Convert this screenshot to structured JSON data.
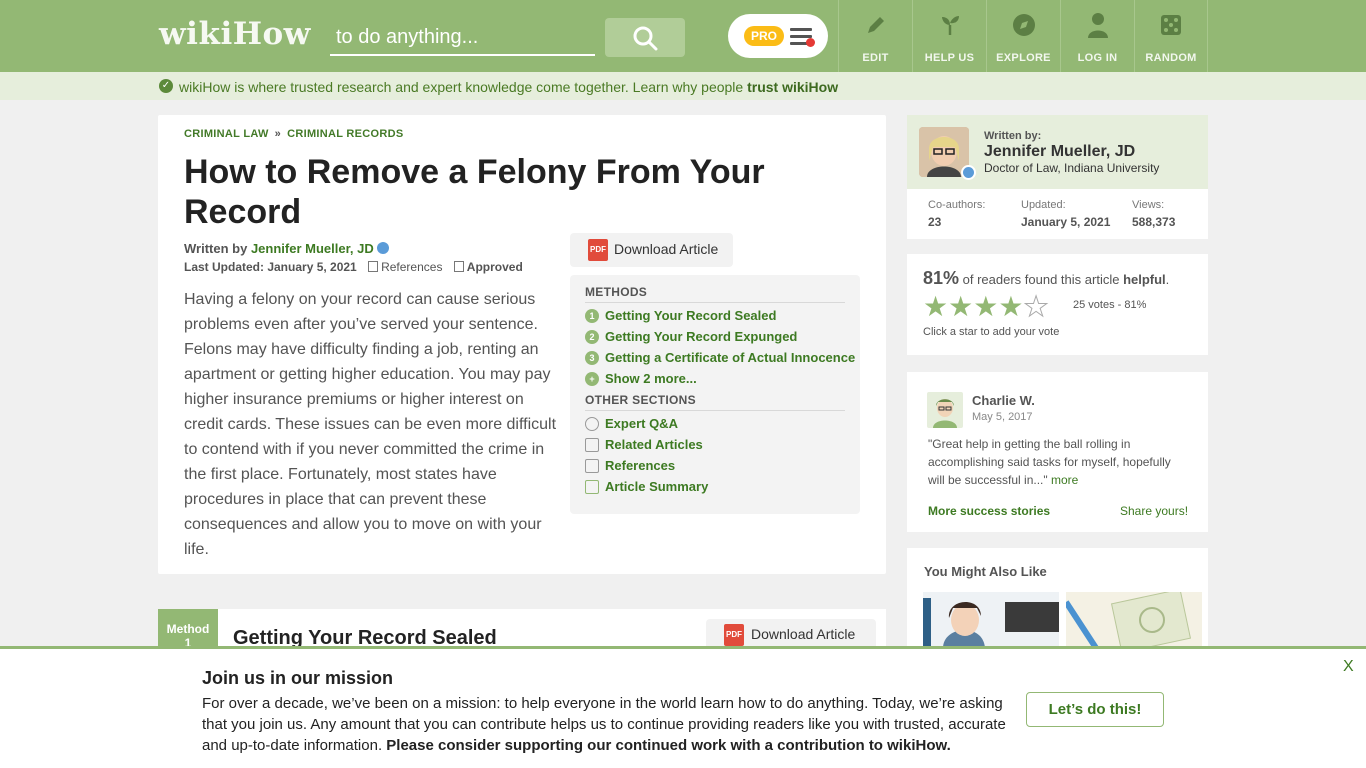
{
  "header": {
    "logo": {
      "wiki": "wiki",
      "how": "How"
    },
    "search_placeholder": "to do anything...",
    "pro_label": "PRO",
    "nav": [
      {
        "label": "EDIT",
        "icon": "pencil-icon"
      },
      {
        "label": "HELP US",
        "icon": "sprout-icon"
      },
      {
        "label": "EXPLORE",
        "icon": "compass-icon"
      },
      {
        "label": "LOG IN",
        "icon": "user-icon"
      },
      {
        "label": "RANDOM",
        "icon": "dice-icon"
      }
    ]
  },
  "trust_bar": {
    "text": "wikiHow is where trusted research and expert knowledge come together. Learn why people ",
    "link": "trust wikiHow"
  },
  "article": {
    "breadcrumb": [
      "CRIMINAL LAW",
      "CRIMINAL RECORDS"
    ],
    "breadcrumb_sep": "»",
    "title": "How to Remove a Felony From Your Record",
    "written_by_label": "Written by ",
    "author": "Jennifer Mueller, JD",
    "last_updated": "Last Updated: January 5, 2021",
    "references_label": "References",
    "approved_label": "Approved",
    "intro": "Having a felony on your record can cause serious problems even after you’ve served your sentence. Felons may have difficulty finding a job, renting an apartment or getting higher education. You may pay higher insurance premiums or higher interest on credit cards. These issues can be even more difficult to contend with if you never committed the crime in the first place. Fortunately, most states have procedures in place that can prevent these consequences and allow you to move on with your life.",
    "download_label": "Download Article",
    "pdf_label": "PDF"
  },
  "toc": {
    "methods_heading": "METHODS",
    "methods": [
      {
        "num": "1",
        "label": "Getting Your Record Sealed"
      },
      {
        "num": "2",
        "label": "Getting Your Record Expunged"
      },
      {
        "num": "3",
        "label": "Getting a Certificate of Actual Innocence"
      },
      {
        "num": "+",
        "label": "Show 2 more..."
      }
    ],
    "other_heading": "OTHER SECTIONS",
    "other": [
      {
        "label": "Expert Q&A",
        "icon": "question-icon"
      },
      {
        "label": "Related Articles",
        "icon": "document-icon"
      },
      {
        "label": "References",
        "icon": "clipboard-icon"
      },
      {
        "label": "Article Summary",
        "icon": "summary-icon"
      }
    ]
  },
  "author_card": {
    "written_by": "Written by:",
    "name": "Jennifer Mueller, JD",
    "credential": "Doctor of Law, Indiana University",
    "coauthors_label": "Co-authors:",
    "coauthors": "23",
    "updated_label": "Updated:",
    "updated": "January 5, 2021",
    "views_label": "Views:",
    "views": "588,373"
  },
  "rating": {
    "percent": "81%",
    "text_pre": " of readers found this article ",
    "text_bold": "helpful",
    "text_post": ".",
    "stars_filled": 4,
    "stars_total": 5,
    "votes": "25 votes - 81%",
    "click_hint": "Click a star to add your vote"
  },
  "success": {
    "name": "Charlie W.",
    "date": "May 5, 2017",
    "quote": "\"Great help in getting the ball rolling in accomplishing said tasks for myself, hopefully will be successful in...\" ",
    "more": "more",
    "more_stories": "More success stories",
    "share": "Share yours!"
  },
  "also_like": {
    "title": "You Might Also Like"
  },
  "method1": {
    "tag": "Method",
    "number": "1",
    "title": "Getting Your Record Sealed",
    "download_label": "Download Article"
  },
  "banner": {
    "heading": "Join us in our mission",
    "body": "For over a decade, we’ve been on a mission: to help everyone in the world learn how to do anything. Today, we’re asking that you join us. Any amount that you can contribute helps us to continue providing readers like you with trusted, accurate and up-to-date information. ",
    "body_bold": "Please consider supporting our continued work with a contribution to wikiHow.",
    "cta": "Let’s do this!",
    "close": "X"
  },
  "colors": {
    "brand_green": "#93b874",
    "link_green": "#3d7a22",
    "pro_yellow": "#fbbc16"
  }
}
